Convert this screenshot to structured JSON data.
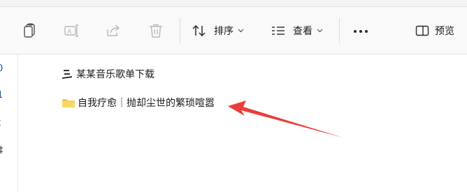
{
  "toolbar": {
    "sort_label": "排序",
    "view_label": "查看",
    "preview_label": "预览"
  },
  "nav_fragments": [
    "0",
    "1",
    "t",
    "‡"
  ],
  "files": [
    {
      "name": "某某音乐歌单下载",
      "icon": "music-file-icon"
    },
    {
      "name": "自我疗愈｜抛却尘世的繁琐喧嚣",
      "icon": "folder-icon"
    }
  ],
  "colors": {
    "accent": "#1f4fa0",
    "folder": "#f2c744",
    "annotation_arrow": "#ea3d3a"
  }
}
